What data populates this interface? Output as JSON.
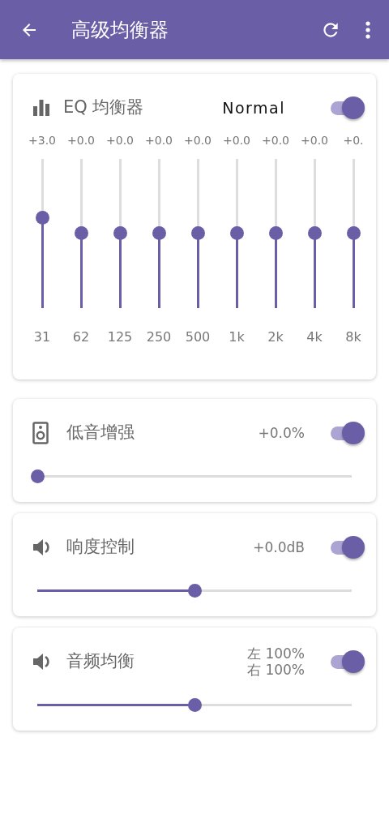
{
  "app_bar": {
    "title": "高级均衡器"
  },
  "eq": {
    "title": "EQ 均衡器",
    "preset": "Normal",
    "on": true,
    "bands": [
      {
        "gain": "+3.0",
        "label": "31",
        "level": 0.6
      },
      {
        "gain": "+0.0",
        "label": "62",
        "level": 0.5
      },
      {
        "gain": "+0.0",
        "label": "125",
        "level": 0.5
      },
      {
        "gain": "+0.0",
        "label": "250",
        "level": 0.5
      },
      {
        "gain": "+0.0",
        "label": "500",
        "level": 0.5
      },
      {
        "gain": "+0.0",
        "label": "1k",
        "level": 0.5
      },
      {
        "gain": "+0.0",
        "label": "2k",
        "level": 0.5
      },
      {
        "gain": "+0.0",
        "label": "4k",
        "level": 0.5
      },
      {
        "gain": "+0.",
        "label": "8k",
        "level": 0.5
      }
    ]
  },
  "effects": [
    {
      "kind": "speaker",
      "title": "低音增强",
      "readings": [
        "+0.0%"
      ],
      "on": true,
      "level": 0
    },
    {
      "kind": "volume",
      "title": "响度控制",
      "readings": [
        "+0.0dB"
      ],
      "on": true,
      "level": 0.5
    },
    {
      "kind": "volume",
      "title": "音频均衡",
      "readings": [
        "左 100%",
        "右 100%"
      ],
      "on": true,
      "level": 0.5
    }
  ]
}
